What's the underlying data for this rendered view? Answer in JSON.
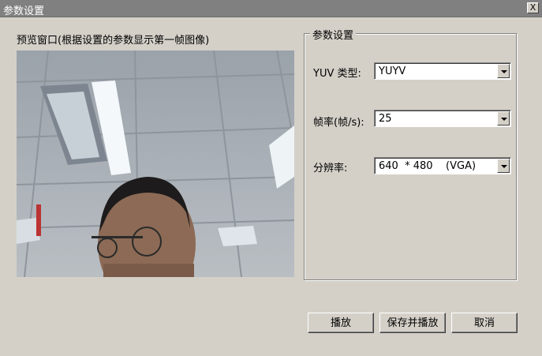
{
  "window": {
    "title": "参数设置",
    "close_glyph": "X"
  },
  "preview": {
    "label": "预览窗口(根据设置的参数显示第一帧图像)"
  },
  "settings": {
    "group_title": "参数设置",
    "yuv_type": {
      "label": "YUV 类型:",
      "value": "YUYV"
    },
    "frame_rate": {
      "label": "帧率(帧/s):",
      "value": "25"
    },
    "resolution": {
      "label": "分辨率:",
      "value": "640  * 480    (VGA)"
    }
  },
  "buttons": {
    "play": "播放",
    "save_and_play": "保存并播放",
    "cancel": "取消"
  }
}
